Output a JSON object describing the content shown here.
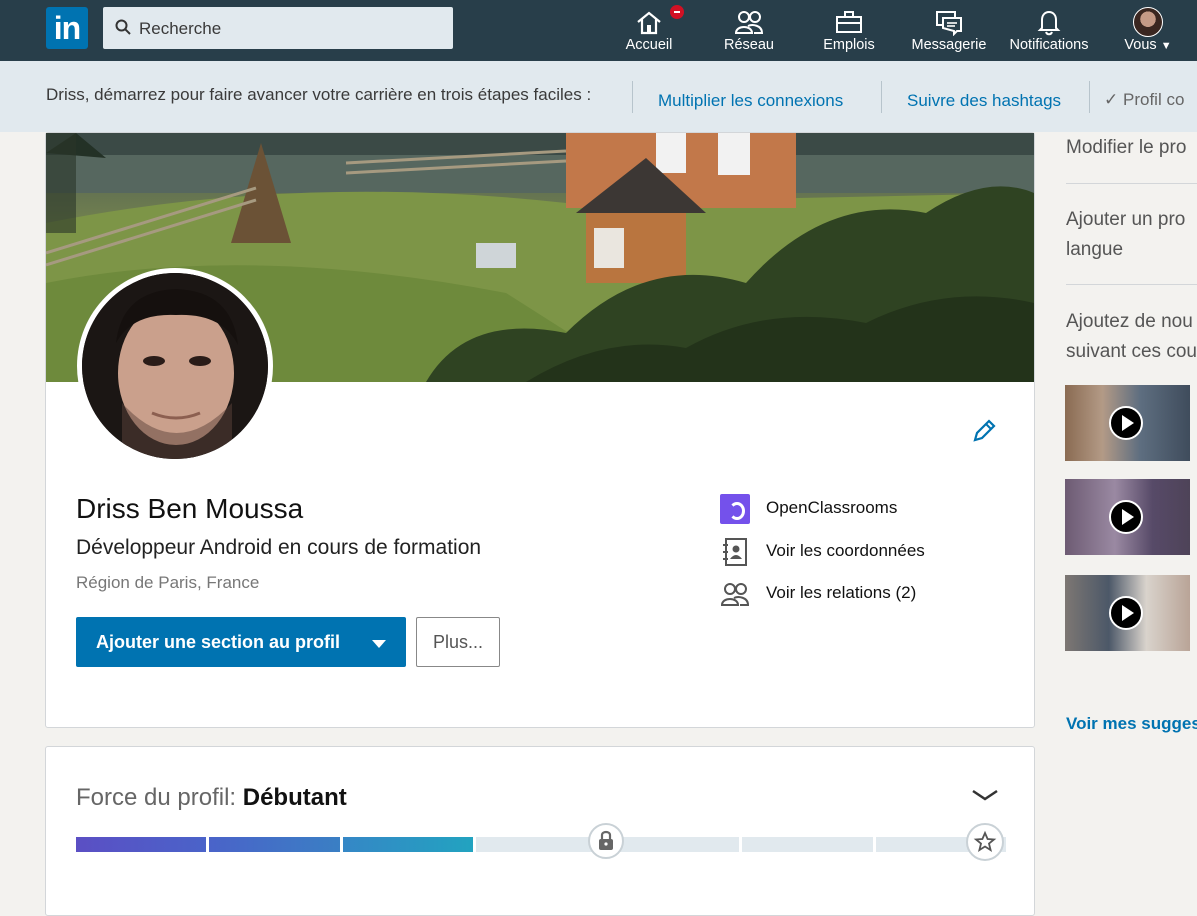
{
  "nav": {
    "search_placeholder": "Recherche",
    "items": [
      {
        "label": "Accueil",
        "icon": "home-icon"
      },
      {
        "label": "Réseau",
        "icon": "network-icon"
      },
      {
        "label": "Emplois",
        "icon": "jobs-icon"
      },
      {
        "label": "Messagerie",
        "icon": "messaging-icon"
      },
      {
        "label": "Notifications",
        "icon": "bell-icon"
      },
      {
        "label": "Vous",
        "icon": "avatar"
      }
    ],
    "colors": {
      "bar": "#283e4a",
      "badge": "#d11124"
    }
  },
  "onboarding": {
    "intro": "Driss, démarrez pour faire avancer votre carrière en trois étapes faciles :",
    "step1": "Multiplier les connexions",
    "step2": "Suivre des hashtags",
    "step3": "Profil co"
  },
  "profile": {
    "name": "Driss Ben Moussa",
    "headline": "Développeur Android en cours de formation",
    "location": "Région de Paris, France",
    "primary_button": "Ajouter une section au profil",
    "secondary_button": "Plus...",
    "school": "OpenClassrooms",
    "contact_link": "Voir les coordonnées",
    "connections_link": "Voir les relations (2)",
    "accent": "#0073b1"
  },
  "strength": {
    "label": "Force du profil:",
    "level": "Débutant",
    "filled_segments": 3,
    "total_segments": 7
  },
  "rail": {
    "edit_profile": "Modifier le pro",
    "add_lang_1": "Ajouter un pro",
    "add_lang_2": "langue",
    "suggest_1": "Ajoutez de nou",
    "suggest_2": "suivant ces cou",
    "see_more": "Voir mes suggest"
  }
}
